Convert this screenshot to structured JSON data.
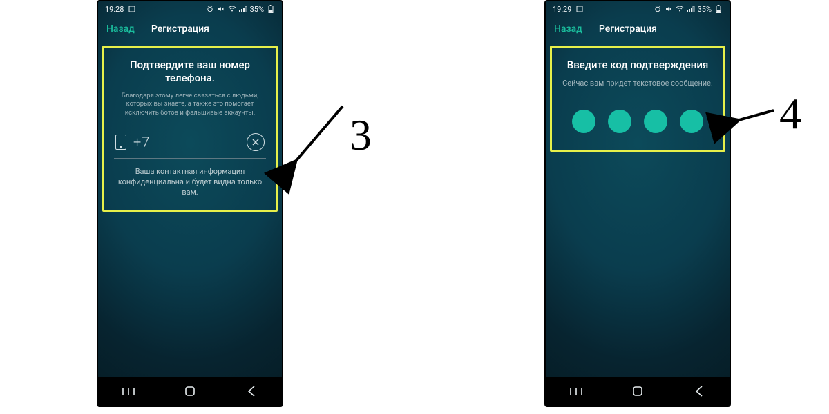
{
  "callouts": {
    "step3": "3",
    "step4": "4"
  },
  "phone1": {
    "status": {
      "time": "19:28",
      "battery": "35%"
    },
    "header": {
      "back": "Назад",
      "title": "Регистрация"
    },
    "card": {
      "title": "Подтвердите ваш номер телефона.",
      "sub": "Благодаря этому легче связаться с людьми, которых вы знаете, а также это помогает исключить ботов и фальшивые аккаунты.",
      "prefix": "+7",
      "foot": "Ваша контактная информация конфиденциальна и будет видна только вам."
    }
  },
  "phone2": {
    "status": {
      "time": "19:29",
      "battery": "35%"
    },
    "header": {
      "back": "Назад",
      "title": "Регистрация"
    },
    "card": {
      "title": "Введите код подтверждения",
      "sub": "Сейчас вам придет текстовое сообщение."
    }
  }
}
